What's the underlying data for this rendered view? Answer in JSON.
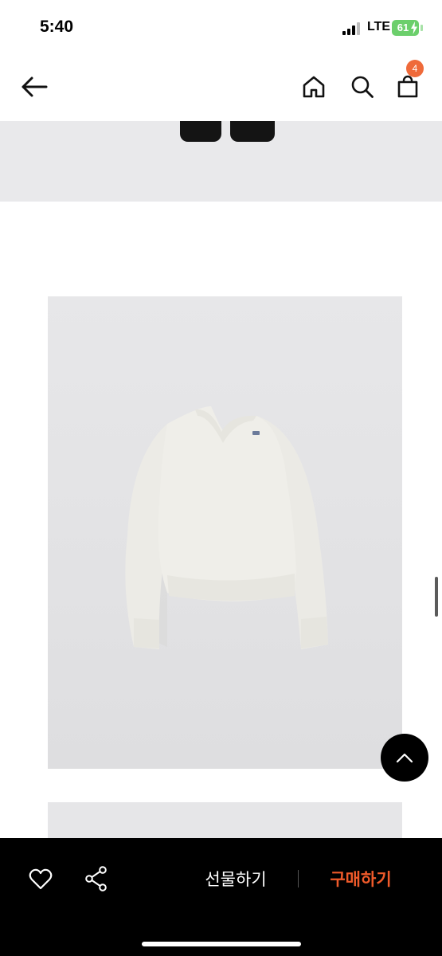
{
  "status_bar": {
    "time": "5:40",
    "network": "LTE",
    "battery": "61"
  },
  "nav": {
    "back_icon": "arrow-left-icon",
    "home_icon": "home-icon",
    "search_icon": "search-icon",
    "cart_icon": "shopping-bag-icon",
    "cart_count": "4"
  },
  "product_images": [
    {
      "subject": "shoes-bottom-crop"
    },
    {
      "subject": "v-neck-sweater"
    },
    {
      "subject": "next-image-partial"
    }
  ],
  "scroll_top_icon": "chevron-up-icon",
  "action_bar": {
    "wish_icon": "heart-icon",
    "share_icon": "share-icon",
    "gift_label": "선물하기",
    "buy_label": "구매하기"
  },
  "colors": {
    "accent": "#ef5a2a",
    "badge": "#ef6a3a",
    "bar_background": "#000000",
    "battery": "#6ccf6c"
  }
}
